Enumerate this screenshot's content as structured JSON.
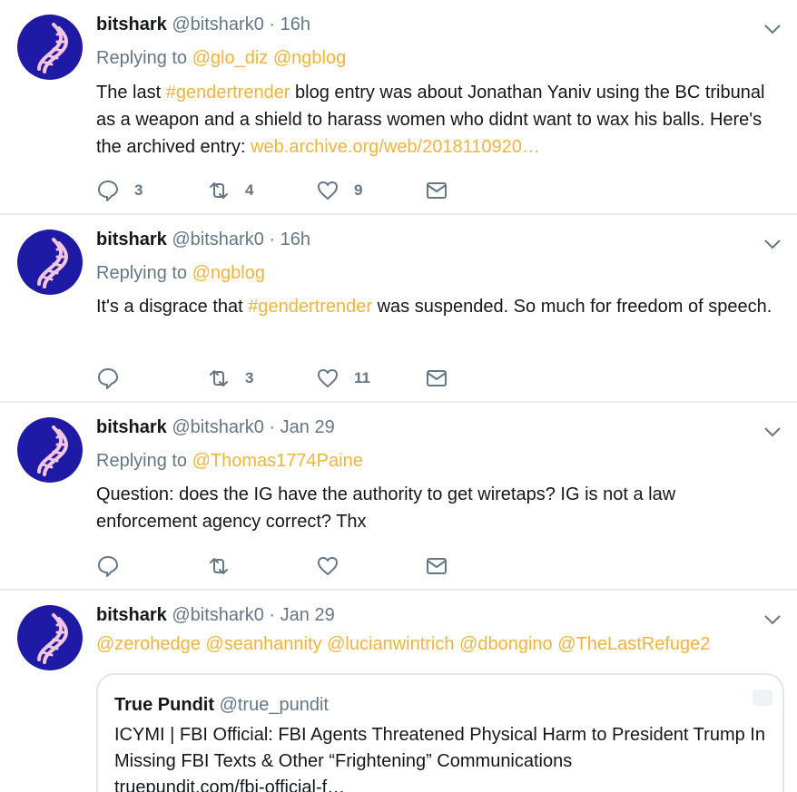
{
  "tweets": [
    {
      "name": "bitshark",
      "handle": "@bitshark0",
      "dot": "·",
      "time": "16h",
      "replying_prefix": "Replying to",
      "replying_to": [
        "@glo_diz",
        "@ngblog"
      ],
      "text_parts": [
        {
          "t": "The last ",
          "link": false
        },
        {
          "t": "#gendertrender",
          "link": true
        },
        {
          "t": " blog entry was about Jonathan Yaniv using the BC tribunal as a weapon and a shield to harass women who didnt want to wax his balls. Here's the archived entry: ",
          "link": false
        },
        {
          "t": "web.archive.org/web/2018110920…",
          "link": true
        }
      ],
      "replies": "3",
      "retweets": "4",
      "likes": "9"
    },
    {
      "name": "bitshark",
      "handle": "@bitshark0",
      "dot": "·",
      "time": "16h",
      "replying_prefix": "Replying to",
      "replying_to": [
        "@ngblog"
      ],
      "text_parts": [
        {
          "t": "It's a disgrace that ",
          "link": false
        },
        {
          "t": "#gendertrender",
          "link": true
        },
        {
          "t": " was suspended. So much for freedom of speech.",
          "link": false
        }
      ],
      "replies": "",
      "retweets": "3",
      "likes": "11"
    },
    {
      "name": "bitshark",
      "handle": "@bitshark0",
      "dot": "·",
      "time": "Jan 29",
      "replying_prefix": "Replying to",
      "replying_to": [
        "@Thomas1774Paine"
      ],
      "text_parts": [
        {
          "t": "Question: does the IG have the authority to get wiretaps? IG is not a law enforcement agency correct? Thx",
          "link": false
        }
      ],
      "replies": "",
      "retweets": "",
      "likes": ""
    },
    {
      "name": "bitshark",
      "handle": "@bitshark0",
      "dot": "·",
      "time": "Jan 29",
      "mentions": [
        "@zerohedge",
        "@seanhannity",
        "@lucianwintrich",
        "@dbongino",
        "@TheLastRefuge2"
      ]
    }
  ],
  "quote": {
    "name": "True Pundit",
    "handle": "@true_pundit",
    "text": "ICYMI | FBI Official: FBI Agents Threatened Physical Harm to President Trump In Missing FBI Texts & Other “Frightening” Communications",
    "link": "truepundit.com/fbi-official-f…"
  },
  "icons": {
    "avatar": "dna-helix-icon",
    "menu": "chevron-down-icon",
    "reply": "reply-bubble-icon",
    "retweet": "retweet-icon",
    "like": "heart-icon",
    "dm": "envelope-icon"
  },
  "colors": {
    "link": "#f0b43c",
    "secondary": "#657786",
    "avatar_bg": "#1f1aa6",
    "divider": "#e6ecf0"
  }
}
